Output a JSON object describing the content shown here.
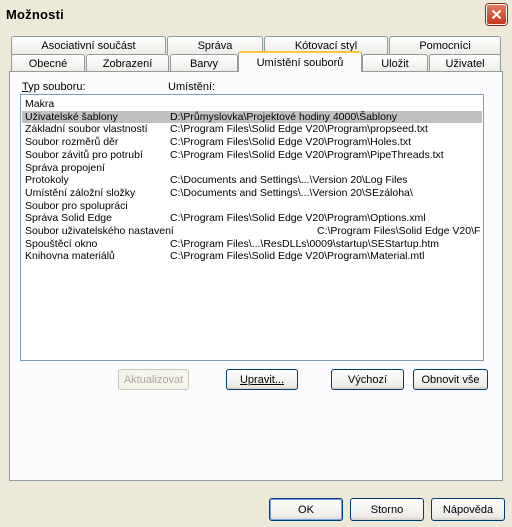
{
  "window": {
    "title": "Možnosti"
  },
  "tabs_row1": [
    {
      "label": "Asociativní součást"
    },
    {
      "label": "Správa"
    },
    {
      "label": "Kótovací styl"
    },
    {
      "label": "Pomocníci"
    }
  ],
  "tabs_row2": [
    {
      "label": "Obecné"
    },
    {
      "label": "Zobrazení"
    },
    {
      "label": "Barvy"
    },
    {
      "label": "Umístění souborů",
      "active": true
    },
    {
      "label": "Uložit"
    },
    {
      "label": "Uživatel"
    }
  ],
  "columns": {
    "type_first": "T",
    "type_rest": "yp souboru:",
    "location": "Umístění:"
  },
  "rows": [
    {
      "name": "Makra",
      "path": ""
    },
    {
      "name": "Uživatelské šablony",
      "path": "D:\\Průmyslovka\\Projektové hodiny 4000\\Šablony",
      "selected": true
    },
    {
      "name": "Základní soubor vlastností",
      "path": "C:\\Program Files\\Solid Edge V20\\Program\\propseed.txt"
    },
    {
      "name": "Soubor rozměrů děr",
      "path": "C:\\Program Files\\Solid Edge V20\\Program\\Holes.txt"
    },
    {
      "name": "Soubor závitů pro potrubí",
      "path": "C:\\Program Files\\Solid Edge V20\\Program\\PipeThreads.txt"
    },
    {
      "name": "Správa propojení",
      "path": ""
    },
    {
      "name": "Protokoly",
      "path": "C:\\Documents and Settings\\...\\Version 20\\Log Files"
    },
    {
      "name": "Umístění záložní složky",
      "path": "C:\\Documents and Settings\\...\\Version 20\\SEzáloha\\"
    },
    {
      "name": "Soubor pro spolupráci",
      "path": ""
    },
    {
      "name": "Správa Solid Edge",
      "path": "C:\\Program Files\\Solid Edge V20\\Program\\Options.xml"
    },
    {
      "name": "Soubor uživatelského nastavení",
      "path": "C:\\Program Files\\Solid Edge V20\\F",
      "offset": true
    },
    {
      "name": "Spouštěcí okno",
      "path": "C:\\Program Files\\...\\ResDLLs\\0009\\startup\\SEStartup.htm"
    },
    {
      "name": "Knihovna materiálů",
      "path": "C:\\Program Files\\Solid Edge V20\\Program\\Material.mtl"
    }
  ],
  "buttons": {
    "update": "Aktualizovat",
    "edit": "Upravit...",
    "default": "Výchozí",
    "restore_all": "Obnovit vše",
    "ok": "OK",
    "cancel": "Storno",
    "help": "Nápověda"
  }
}
